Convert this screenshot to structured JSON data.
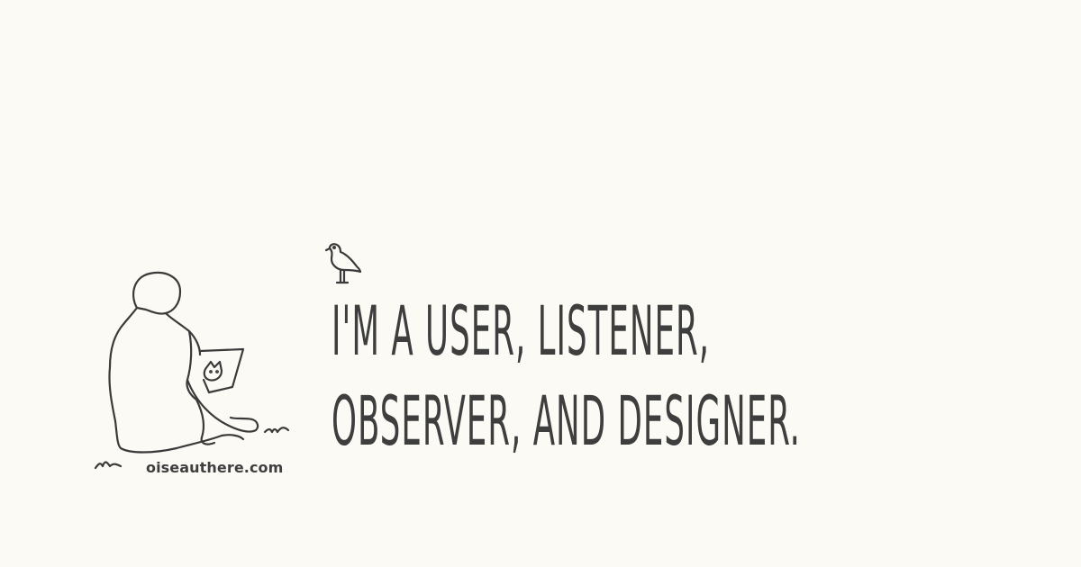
{
  "headline": {
    "line1": "I'm a user, listener,",
    "line2": "observer, and designer."
  },
  "site": {
    "domain": "oiseauthere.com"
  },
  "icons": {
    "person": "person-with-laptop-icon",
    "bird": "bird-icon",
    "grass": "grass-icon"
  },
  "colors": {
    "background": "#fbfaf4",
    "ink": "#3e3e3e"
  }
}
